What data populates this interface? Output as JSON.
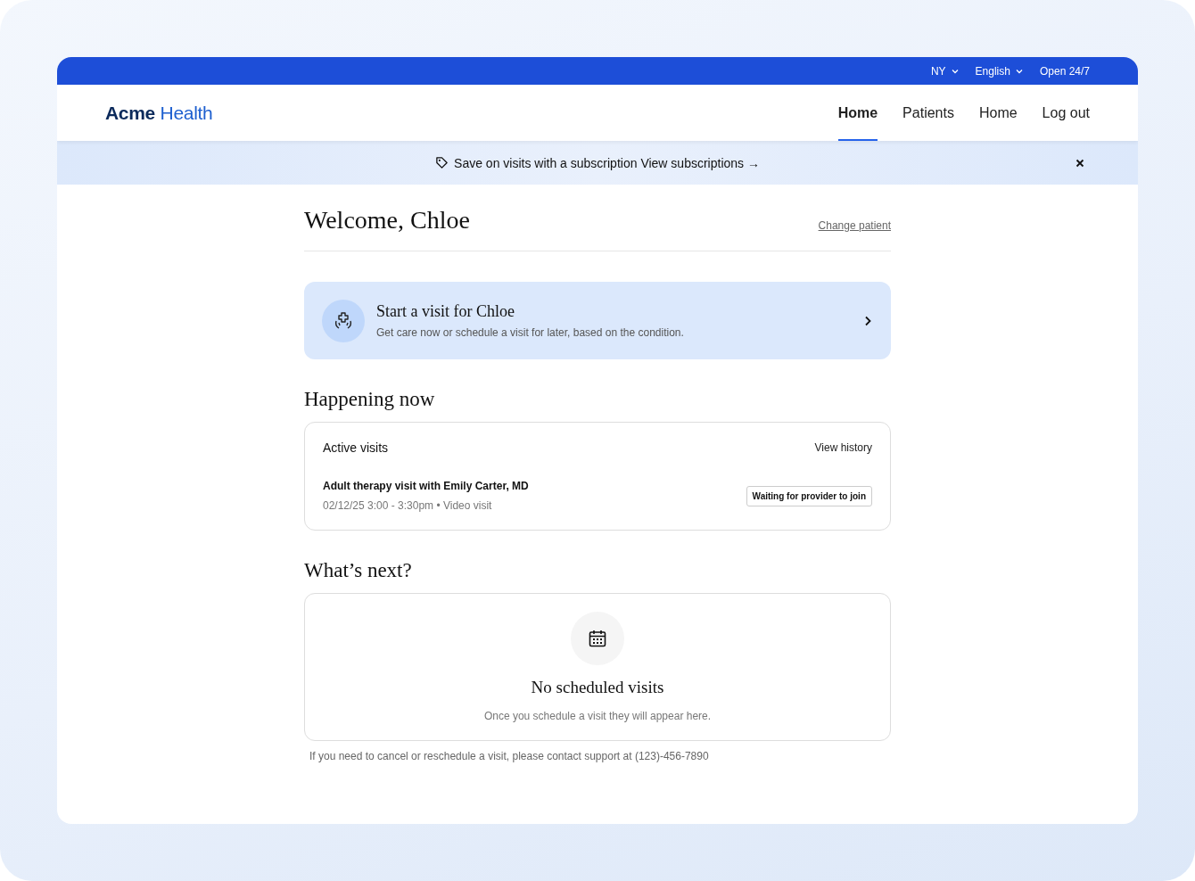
{
  "topbar": {
    "items": [
      {
        "label": "NY",
        "kind": "dropdown"
      },
      {
        "label": "English",
        "kind": "dropdown"
      },
      {
        "label": "Open 24/7",
        "kind": "text"
      }
    ]
  },
  "header": {
    "logo": {
      "brand": "Acme",
      "product": "Health"
    },
    "nav": [
      {
        "label": "Home",
        "selected": true
      },
      {
        "label": "Patients",
        "selected": false
      },
      {
        "label": "Home",
        "selected": false
      },
      {
        "label": "Log out",
        "selected": false
      }
    ]
  },
  "banner": {
    "text": "Save on visits with a subscription",
    "link": "View subscriptions →"
  },
  "welcome": {
    "title": "Welcome, Chloe",
    "action": "Change patient"
  },
  "start_visit": {
    "title": "Start a visit for Chloe",
    "subtitle": "Get care now or schedule a visit for later, based on the condition."
  },
  "happening_now": {
    "title": "Happening now",
    "card_title": "Active visits",
    "action": "View history",
    "visits": [
      {
        "title": "Adult therapy visit with Emily Carter, MD",
        "details": "02/12/25 3:00 - 3:30pm • Video visit",
        "status": "Waiting for provider to join"
      }
    ]
  },
  "whats_next": {
    "title": "What’s next?",
    "empty_title": "No scheduled visits",
    "empty_text": "Once you schedule a visit they will appear here."
  },
  "footer_note": "If you need to cancel or reschedule a visit, please contact support at (123)-456-7890"
}
